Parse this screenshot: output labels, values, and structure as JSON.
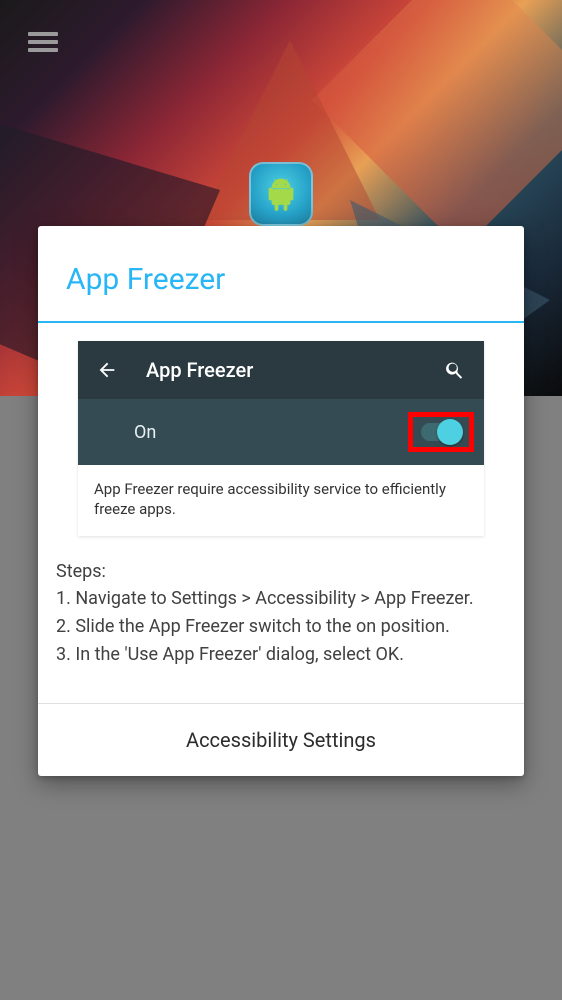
{
  "dialog": {
    "title": "App Freezer",
    "screenshot": {
      "toolbar_title": "App Freezer",
      "row_label": "On",
      "caption": "App Freezer require accessibility service to efficiently freeze apps."
    },
    "steps_heading": "Steps:",
    "steps": {
      "s1": "1. Navigate to Settings > Accessibility > App Freezer.",
      "s2": "2. Slide the App Freezer switch to the on position.",
      "s3": "3. In the 'Use App Freezer' dialog, select OK."
    },
    "footer_button": "Accessibility Settings"
  },
  "icons": {
    "hamburger": "hamburger-icon",
    "app": "app-freezer-icon",
    "back": "back-arrow-icon",
    "search": "search-icon",
    "toggle": "toggle-on"
  }
}
